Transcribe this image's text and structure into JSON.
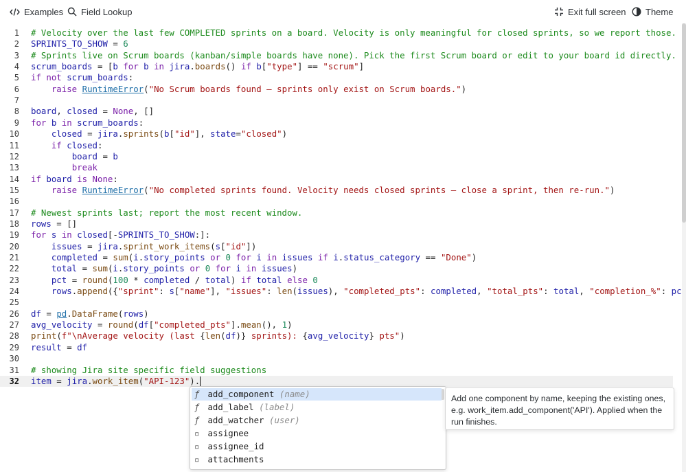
{
  "toolbar": {
    "examples_label": "Examples",
    "field_lookup_label": "Field Lookup",
    "exit_fullscreen_label": "Exit full screen",
    "theme_label": "Theme"
  },
  "editor": {
    "lines": [
      {
        "n": "1",
        "tokens": [
          [
            "c-com",
            "# Velocity over the last few COMPLETED sprints on a board. Velocity is only meaningful for closed sprints, so we report those."
          ]
        ]
      },
      {
        "n": "2",
        "tokens": [
          [
            "c-var",
            "SPRINTS_TO_SHOW"
          ],
          [
            "c-op",
            " = "
          ],
          [
            "c-num",
            "6"
          ]
        ]
      },
      {
        "n": "3",
        "tokens": [
          [
            "c-com",
            "# Sprints live on Scrum boards (kanban/simple boards have none). Pick the first Scrum board or edit to your board id directly."
          ]
        ]
      },
      {
        "n": "4",
        "tokens": [
          [
            "c-var",
            "scrum_boards"
          ],
          [
            "c-op",
            " = ["
          ],
          [
            "c-var",
            "b"
          ],
          [
            "c-kw",
            " for "
          ],
          [
            "c-var",
            "b"
          ],
          [
            "c-kw",
            " in "
          ],
          [
            "c-var",
            "jira"
          ],
          [
            "c-op",
            "."
          ],
          [
            "c-fn",
            "boards"
          ],
          [
            "c-op",
            "() "
          ],
          [
            "c-kw",
            "if "
          ],
          [
            "c-var",
            "b"
          ],
          [
            "c-op",
            "["
          ],
          [
            "c-str",
            "\"type\""
          ],
          [
            "c-op",
            "] == "
          ],
          [
            "c-str",
            "\"scrum\""
          ],
          [
            "c-op",
            "]"
          ]
        ]
      },
      {
        "n": "5",
        "tokens": [
          [
            "c-kw",
            "if not "
          ],
          [
            "c-var",
            "scrum_boards"
          ],
          [
            "c-op",
            ":"
          ]
        ]
      },
      {
        "n": "6",
        "tokens": [
          [
            "c-op",
            "    "
          ],
          [
            "c-kw",
            "raise "
          ],
          [
            "c-cls",
            "RuntimeError"
          ],
          [
            "c-op",
            "("
          ],
          [
            "c-str",
            "\"No Scrum boards found — sprints only exist on Scrum boards.\""
          ],
          [
            "c-op",
            ")"
          ]
        ]
      },
      {
        "n": "7",
        "tokens": []
      },
      {
        "n": "8",
        "tokens": [
          [
            "c-var",
            "board"
          ],
          [
            "c-op",
            ", "
          ],
          [
            "c-var",
            "closed"
          ],
          [
            "c-op",
            " = "
          ],
          [
            "c-kw",
            "None"
          ],
          [
            "c-op",
            ", []"
          ]
        ]
      },
      {
        "n": "9",
        "tokens": [
          [
            "c-kw",
            "for "
          ],
          [
            "c-var",
            "b"
          ],
          [
            "c-kw",
            " in "
          ],
          [
            "c-var",
            "scrum_boards"
          ],
          [
            "c-op",
            ":"
          ]
        ]
      },
      {
        "n": "10",
        "tokens": [
          [
            "c-op",
            "    "
          ],
          [
            "c-var",
            "closed"
          ],
          [
            "c-op",
            " = "
          ],
          [
            "c-var",
            "jira"
          ],
          [
            "c-op",
            "."
          ],
          [
            "c-fn",
            "sprints"
          ],
          [
            "c-op",
            "("
          ],
          [
            "c-var",
            "b"
          ],
          [
            "c-op",
            "["
          ],
          [
            "c-str",
            "\"id\""
          ],
          [
            "c-op",
            "], "
          ],
          [
            "c-var",
            "state"
          ],
          [
            "c-op",
            "="
          ],
          [
            "c-str",
            "\"closed\""
          ],
          [
            "c-op",
            ")"
          ]
        ]
      },
      {
        "n": "11",
        "tokens": [
          [
            "c-op",
            "    "
          ],
          [
            "c-kw",
            "if "
          ],
          [
            "c-var",
            "closed"
          ],
          [
            "c-op",
            ":"
          ]
        ]
      },
      {
        "n": "12",
        "tokens": [
          [
            "c-op",
            "        "
          ],
          [
            "c-var",
            "board"
          ],
          [
            "c-op",
            " = "
          ],
          [
            "c-var",
            "b"
          ]
        ]
      },
      {
        "n": "13",
        "tokens": [
          [
            "c-op",
            "        "
          ],
          [
            "c-kw",
            "break"
          ]
        ]
      },
      {
        "n": "14",
        "tokens": [
          [
            "c-kw",
            "if "
          ],
          [
            "c-var",
            "board"
          ],
          [
            "c-kw",
            " is "
          ],
          [
            "c-kw",
            "None"
          ],
          [
            "c-op",
            ":"
          ]
        ]
      },
      {
        "n": "15",
        "tokens": [
          [
            "c-op",
            "    "
          ],
          [
            "c-kw",
            "raise "
          ],
          [
            "c-cls",
            "RuntimeError"
          ],
          [
            "c-op",
            "("
          ],
          [
            "c-str",
            "\"No completed sprints found. Velocity needs closed sprints — close a sprint, then re-run.\""
          ],
          [
            "c-op",
            ")"
          ]
        ]
      },
      {
        "n": "16",
        "tokens": []
      },
      {
        "n": "17",
        "tokens": [
          [
            "c-com",
            "# Newest sprints last; report the most recent window."
          ]
        ]
      },
      {
        "n": "18",
        "tokens": [
          [
            "c-var",
            "rows"
          ],
          [
            "c-op",
            " = []"
          ]
        ]
      },
      {
        "n": "19",
        "tokens": [
          [
            "c-kw",
            "for "
          ],
          [
            "c-var",
            "s"
          ],
          [
            "c-kw",
            " in "
          ],
          [
            "c-var",
            "closed"
          ],
          [
            "c-op",
            "[-"
          ],
          [
            "c-var",
            "SPRINTS_TO_SHOW"
          ],
          [
            "c-op",
            ":]:"
          ]
        ]
      },
      {
        "n": "20",
        "tokens": [
          [
            "c-op",
            "    "
          ],
          [
            "c-var",
            "issues"
          ],
          [
            "c-op",
            " = "
          ],
          [
            "c-var",
            "jira"
          ],
          [
            "c-op",
            "."
          ],
          [
            "c-fn",
            "sprint_work_items"
          ],
          [
            "c-op",
            "("
          ],
          [
            "c-var",
            "s"
          ],
          [
            "c-op",
            "["
          ],
          [
            "c-str",
            "\"id\""
          ],
          [
            "c-op",
            "])"
          ]
        ]
      },
      {
        "n": "21",
        "tokens": [
          [
            "c-op",
            "    "
          ],
          [
            "c-var",
            "completed"
          ],
          [
            "c-op",
            " = "
          ],
          [
            "c-fn",
            "sum"
          ],
          [
            "c-op",
            "("
          ],
          [
            "c-var",
            "i"
          ],
          [
            "c-op",
            "."
          ],
          [
            "c-var",
            "story_points"
          ],
          [
            "c-kw",
            " or "
          ],
          [
            "c-num",
            "0"
          ],
          [
            "c-kw",
            " for "
          ],
          [
            "c-var",
            "i"
          ],
          [
            "c-kw",
            " in "
          ],
          [
            "c-var",
            "issues"
          ],
          [
            "c-kw",
            " if "
          ],
          [
            "c-var",
            "i"
          ],
          [
            "c-op",
            "."
          ],
          [
            "c-var",
            "status_category"
          ],
          [
            "c-op",
            " == "
          ],
          [
            "c-str",
            "\"Done\""
          ],
          [
            "c-op",
            ")"
          ]
        ]
      },
      {
        "n": "22",
        "tokens": [
          [
            "c-op",
            "    "
          ],
          [
            "c-var",
            "total"
          ],
          [
            "c-op",
            " = "
          ],
          [
            "c-fn",
            "sum"
          ],
          [
            "c-op",
            "("
          ],
          [
            "c-var",
            "i"
          ],
          [
            "c-op",
            "."
          ],
          [
            "c-var",
            "story_points"
          ],
          [
            "c-kw",
            " or "
          ],
          [
            "c-num",
            "0"
          ],
          [
            "c-kw",
            " for "
          ],
          [
            "c-var",
            "i"
          ],
          [
            "c-kw",
            " in "
          ],
          [
            "c-var",
            "issues"
          ],
          [
            "c-op",
            ")"
          ]
        ]
      },
      {
        "n": "23",
        "tokens": [
          [
            "c-op",
            "    "
          ],
          [
            "c-var",
            "pct"
          ],
          [
            "c-op",
            " = "
          ],
          [
            "c-fn",
            "round"
          ],
          [
            "c-op",
            "("
          ],
          [
            "c-num",
            "100"
          ],
          [
            "c-op",
            " * "
          ],
          [
            "c-var",
            "completed"
          ],
          [
            "c-op",
            " / "
          ],
          [
            "c-var",
            "total"
          ],
          [
            "c-op",
            ") "
          ],
          [
            "c-kw",
            "if "
          ],
          [
            "c-var",
            "total"
          ],
          [
            "c-kw",
            " else "
          ],
          [
            "c-num",
            "0"
          ]
        ]
      },
      {
        "n": "24",
        "tokens": [
          [
            "c-op",
            "    "
          ],
          [
            "c-var",
            "rows"
          ],
          [
            "c-op",
            "."
          ],
          [
            "c-fn",
            "append"
          ],
          [
            "c-op",
            "({"
          ],
          [
            "c-str",
            "\"sprint\""
          ],
          [
            "c-op",
            ": "
          ],
          [
            "c-var",
            "s"
          ],
          [
            "c-op",
            "["
          ],
          [
            "c-str",
            "\"name\""
          ],
          [
            "c-op",
            "], "
          ],
          [
            "c-str",
            "\"issues\""
          ],
          [
            "c-op",
            ": "
          ],
          [
            "c-fn",
            "len"
          ],
          [
            "c-op",
            "("
          ],
          [
            "c-var",
            "issues"
          ],
          [
            "c-op",
            "), "
          ],
          [
            "c-str",
            "\"completed_pts\""
          ],
          [
            "c-op",
            ": "
          ],
          [
            "c-var",
            "completed"
          ],
          [
            "c-op",
            ", "
          ],
          [
            "c-str",
            "\"total_pts\""
          ],
          [
            "c-op",
            ": "
          ],
          [
            "c-var",
            "total"
          ],
          [
            "c-op",
            ", "
          ],
          [
            "c-str",
            "\"completion_%\""
          ],
          [
            "c-op",
            ": "
          ],
          [
            "c-var",
            "pct"
          ],
          [
            "c-op",
            "})"
          ]
        ]
      },
      {
        "n": "25",
        "tokens": []
      },
      {
        "n": "26",
        "tokens": [
          [
            "c-var",
            "df"
          ],
          [
            "c-op",
            " = "
          ],
          [
            "c-mod",
            "pd"
          ],
          [
            "c-op",
            "."
          ],
          [
            "c-fn",
            "DataFrame"
          ],
          [
            "c-op",
            "("
          ],
          [
            "c-var",
            "rows"
          ],
          [
            "c-op",
            ")"
          ]
        ]
      },
      {
        "n": "27",
        "tokens": [
          [
            "c-var",
            "avg_velocity"
          ],
          [
            "c-op",
            " = "
          ],
          [
            "c-fn",
            "round"
          ],
          [
            "c-op",
            "("
          ],
          [
            "c-var",
            "df"
          ],
          [
            "c-op",
            "["
          ],
          [
            "c-str",
            "\"completed_pts\""
          ],
          [
            "c-op",
            "]."
          ],
          [
            "c-fn",
            "mean"
          ],
          [
            "c-op",
            "(), "
          ],
          [
            "c-num",
            "1"
          ],
          [
            "c-op",
            ")"
          ]
        ]
      },
      {
        "n": "28",
        "tokens": [
          [
            "c-fn",
            "print"
          ],
          [
            "c-op",
            "("
          ],
          [
            "c-str",
            "f\"\\nAverage velocity (last "
          ],
          [
            "c-op",
            "{"
          ],
          [
            "c-fn",
            "len"
          ],
          [
            "c-op",
            "("
          ],
          [
            "c-var",
            "df"
          ],
          [
            "c-op",
            ")}"
          ],
          [
            "c-str",
            " sprints): "
          ],
          [
            "c-op",
            "{"
          ],
          [
            "c-var",
            "avg_velocity"
          ],
          [
            "c-op",
            "}"
          ],
          [
            "c-str",
            " pts\""
          ],
          [
            "c-op",
            ")"
          ]
        ]
      },
      {
        "n": "29",
        "tokens": [
          [
            "c-var",
            "result"
          ],
          [
            "c-op",
            " = "
          ],
          [
            "c-var",
            "df"
          ]
        ]
      },
      {
        "n": "30",
        "tokens": []
      },
      {
        "n": "31",
        "tokens": [
          [
            "c-com",
            "# showing Jira site specific field suggestions"
          ]
        ]
      },
      {
        "n": "32",
        "tokens": [
          [
            "c-var",
            "item"
          ],
          [
            "c-op",
            " = "
          ],
          [
            "c-var",
            "jira"
          ],
          [
            "c-op",
            "."
          ],
          [
            "c-fn",
            "work_item"
          ],
          [
            "c-op",
            "("
          ],
          [
            "c-str",
            "\"API-123\""
          ],
          [
            "c-op",
            ")."
          ]
        ],
        "active": true
      }
    ]
  },
  "autocomplete": {
    "items": [
      {
        "icon": "ƒ",
        "label": "add_component",
        "hint": "(name)",
        "selected": true
      },
      {
        "icon": "ƒ",
        "label": "add_label",
        "hint": "(label)",
        "selected": false
      },
      {
        "icon": "ƒ",
        "label": "add_watcher",
        "hint": "(user)",
        "selected": false
      },
      {
        "icon": "▫",
        "label": "assignee",
        "hint": "",
        "selected": false
      },
      {
        "icon": "▫",
        "label": "assignee_id",
        "hint": "",
        "selected": false
      },
      {
        "icon": "▫",
        "label": "attachments",
        "hint": "",
        "selected": false
      }
    ],
    "doc": "Add one component by name, keeping the existing ones, e.g. work_item.add_component('API'). Applied when the run finishes."
  }
}
